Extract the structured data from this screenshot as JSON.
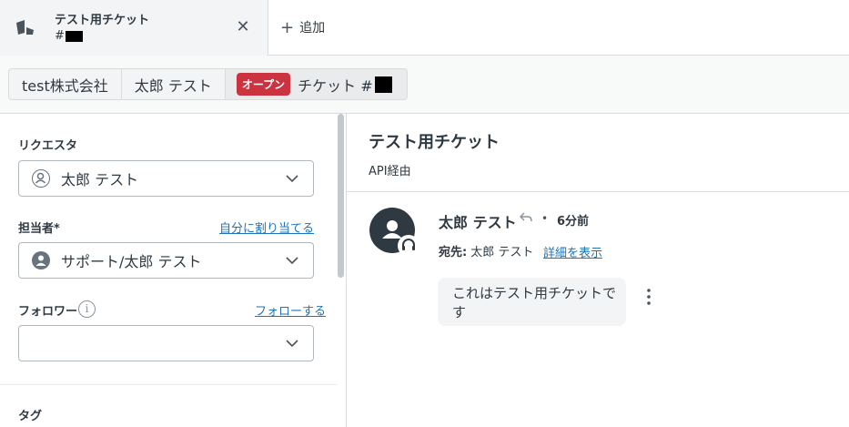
{
  "tabs": {
    "ticket_tab": {
      "title": "テスト用チケット",
      "number_prefix": "#"
    },
    "add_label": "追加"
  },
  "breadcrumb": {
    "organization": "test株式会社",
    "requester": "太郎 テスト",
    "status": "オープン",
    "ticket_label": "チケット #"
  },
  "properties": {
    "requester_label": "リクエスタ",
    "requester_value": "太郎 テスト",
    "assignee_label": "担当者*",
    "assign_self_link": "自分に割り当てる",
    "assignee_value": "サポート/太郎 テスト",
    "followers_label": "フォロワー",
    "follow_link": "フォローする",
    "followers_value": "",
    "tags_label": "タグ"
  },
  "conversation": {
    "title": "テスト用チケット",
    "via": "API経由",
    "message": {
      "author": "太郎 テスト",
      "time": "6分前",
      "to_label": "宛先:",
      "to_value": "太郎 テスト",
      "details_link": "詳細を表示",
      "body": "これはテスト用チケットです"
    }
  },
  "colors": {
    "status_open": "#cc3340",
    "link": "#1f73b7",
    "text": "#2f3941",
    "border": "#d8dcde"
  },
  "icons": [
    "zendesk-logo-icon",
    "close-icon",
    "plus-icon",
    "user-icon",
    "chevron-down-icon",
    "info-icon",
    "headset-icon",
    "reply-icon",
    "more-vertical-icon"
  ]
}
